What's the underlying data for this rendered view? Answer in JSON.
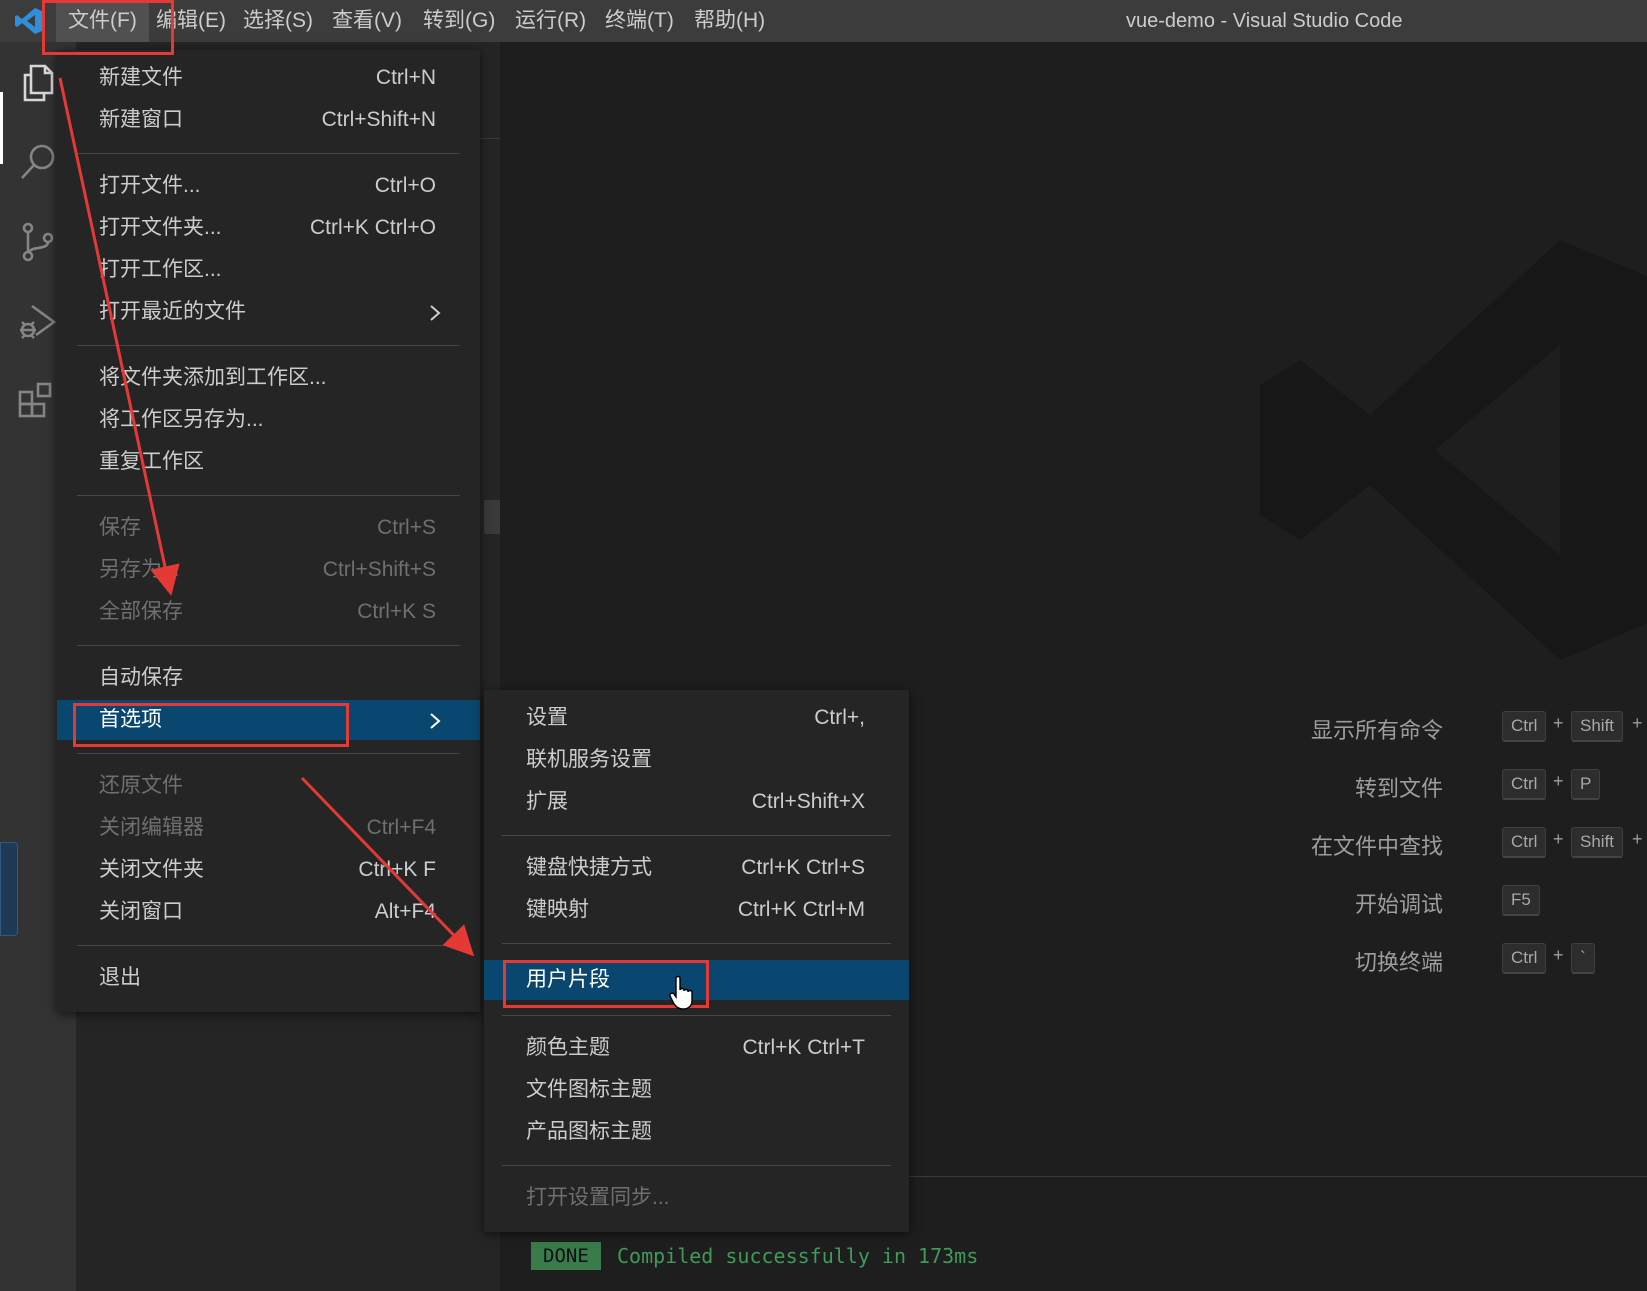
{
  "titlebar": {
    "menus": [
      "文件(F)",
      "编辑(E)",
      "选择(S)",
      "查看(V)",
      "转到(G)",
      "运行(R)",
      "终端(T)",
      "帮助(H)"
    ],
    "window_title": "vue-demo - Visual Studio Code"
  },
  "activity_bar": {
    "items": [
      "explorer-icon",
      "search-icon",
      "source-control-icon",
      "run-debug-icon",
      "extensions-icon"
    ]
  },
  "file_menu": {
    "groups": [
      [
        {
          "label": "新建文件",
          "key": "Ctrl+N"
        },
        {
          "label": "新建窗口",
          "key": "Ctrl+Shift+N"
        }
      ],
      [
        {
          "label": "打开文件...",
          "key": "Ctrl+O"
        },
        {
          "label": "打开文件夹...",
          "key": "Ctrl+K Ctrl+O"
        },
        {
          "label": "打开工作区...",
          "key": ""
        },
        {
          "label": "打开最近的文件",
          "key": ""
        }
      ],
      [
        {
          "label": "将文件夹添加到工作区...",
          "key": ""
        },
        {
          "label": "将工作区另存为...",
          "key": ""
        },
        {
          "label": "重复工作区",
          "key": ""
        }
      ],
      [
        {
          "label": "保存",
          "key": "Ctrl+S"
        },
        {
          "label": "另存为...",
          "key": "Ctrl+Shift+S"
        },
        {
          "label": "全部保存",
          "key": "Ctrl+K S"
        }
      ],
      [
        {
          "label": "自动保存",
          "key": ""
        },
        {
          "label": "首选项",
          "key": ""
        }
      ],
      [
        {
          "label": "还原文件",
          "key": ""
        },
        {
          "label": "关闭编辑器",
          "key": "Ctrl+F4"
        },
        {
          "label": "关闭文件夹",
          "key": "Ctrl+K F"
        },
        {
          "label": "关闭窗口",
          "key": "Alt+F4"
        }
      ],
      [
        {
          "label": "退出",
          "key": ""
        }
      ]
    ]
  },
  "preferences_menu": {
    "groups": [
      [
        {
          "label": "设置",
          "key": "Ctrl+,"
        },
        {
          "label": "联机服务设置",
          "key": ""
        },
        {
          "label": "扩展",
          "key": "Ctrl+Shift+X"
        }
      ],
      [
        {
          "label": "键盘快捷方式",
          "key": "Ctrl+K Ctrl+S"
        },
        {
          "label": "键映射",
          "key": "Ctrl+K Ctrl+M"
        }
      ],
      [
        {
          "label": "用户片段",
          "key": ""
        }
      ],
      [
        {
          "label": "颜色主题",
          "key": "Ctrl+K Ctrl+T"
        },
        {
          "label": "文件图标主题",
          "key": ""
        },
        {
          "label": "产品图标主题",
          "key": ""
        }
      ],
      [
        {
          "label": "打开设置同步...",
          "key": ""
        }
      ]
    ]
  },
  "welcome_shortcuts": [
    {
      "label": "显示所有命令",
      "keys": [
        "Ctrl",
        "Shift"
      ]
    },
    {
      "label": "转到文件",
      "keys": [
        "Ctrl",
        "P"
      ]
    },
    {
      "label": "在文件中查找",
      "keys": [
        "Ctrl",
        "Shift"
      ]
    },
    {
      "label": "开始调试",
      "keys": [
        "F5"
      ]
    },
    {
      "label": "切换终端",
      "keys": [
        "Ctrl",
        "`"
      ]
    }
  ],
  "kbd_plus": "+",
  "terminal": {
    "badge": "DONE",
    "message": "Compiled successfully in 173ms"
  },
  "colors": {
    "accent_blue": "#094771",
    "annotation_red": "#e53935",
    "done_green": "#3b7a4a"
  }
}
